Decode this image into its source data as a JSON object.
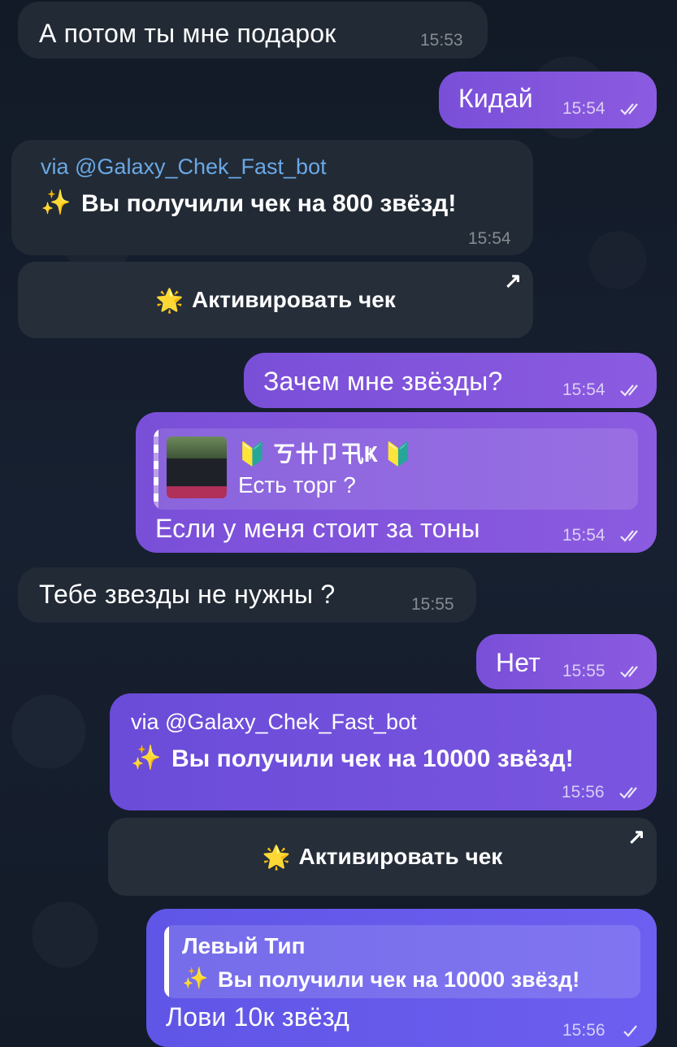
{
  "messages": {
    "m1": {
      "text": "А потом ты мне подарок",
      "time": "15:53"
    },
    "m2": {
      "text": "Кидай",
      "time": "15:54"
    },
    "m3": {
      "via": "via @Galaxy_Chek_Fast_bot",
      "emoji": "✨",
      "text": "Вы получили чек на 800 звёзд!",
      "time": "15:54",
      "button": "Активировать чек",
      "button_emoji": "🌟",
      "button_arrow": "↗"
    },
    "m4": {
      "text": "Зачем мне звёзды?",
      "time": "15:54"
    },
    "m5": {
      "reply_name": "🔰 ㄎ卄卩卂Ҝ 🔰",
      "reply_text": "Есть торг ?",
      "text": "Если у меня стоит за тоны",
      "time": "15:54"
    },
    "m6": {
      "text": "Тебе звезды не нужны ?",
      "time": "15:55"
    },
    "m7": {
      "text": "Нет",
      "time": "15:55"
    },
    "m8": {
      "via": "via @Galaxy_Chek_Fast_bot",
      "emoji": "✨",
      "text": "Вы получили чек на 10000 звёзд!",
      "time": "15:56",
      "button": "Активировать чек",
      "button_emoji": "🌟",
      "button_arrow": "↗"
    },
    "m9": {
      "reply_name": "Левый Тип",
      "reply_emoji": "✨",
      "reply_text": "Вы получили чек на 10000 звёзд!",
      "text": "Лови 10к звёзд",
      "time": "15:56"
    }
  },
  "colors": {
    "background": "#141c2a",
    "incoming_bubble": "#222a35",
    "outgoing_bubble": "#8b5be0",
    "outgoing_bubble_alt": "#6d5ff0",
    "link": "#6aa8e6"
  }
}
